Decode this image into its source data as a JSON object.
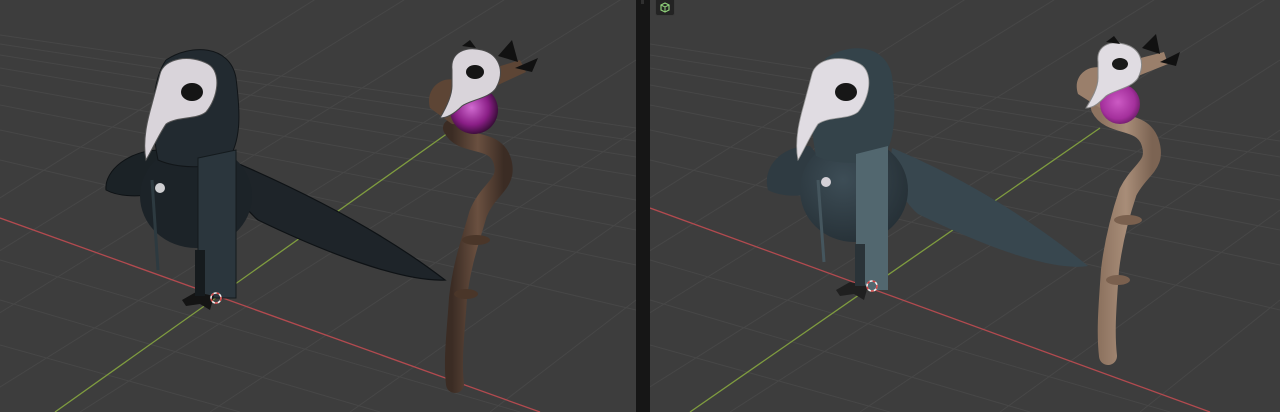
{
  "app": {
    "layout": "two-viewports",
    "background_color": "#3d3d3d"
  },
  "viewports": [
    {
      "id": "left",
      "shading": "toon",
      "objects": [
        "plague-doctor-bird",
        "staff-with-orb"
      ]
    },
    {
      "id": "right",
      "shading": "solid",
      "header_icon": "object-mode-icon",
      "objects": [
        "plague-doctor-bird",
        "staff-with-orb"
      ]
    }
  ],
  "colors": {
    "x_axis": "#b24a4f",
    "y_axis": "#7f9c3f",
    "grid": "#4a4a4a",
    "mask": "#d9d4da",
    "orb": "#a4309c",
    "staff": "#6a5040",
    "body_toon": "#1e2429",
    "body_solid": "#38474f"
  }
}
